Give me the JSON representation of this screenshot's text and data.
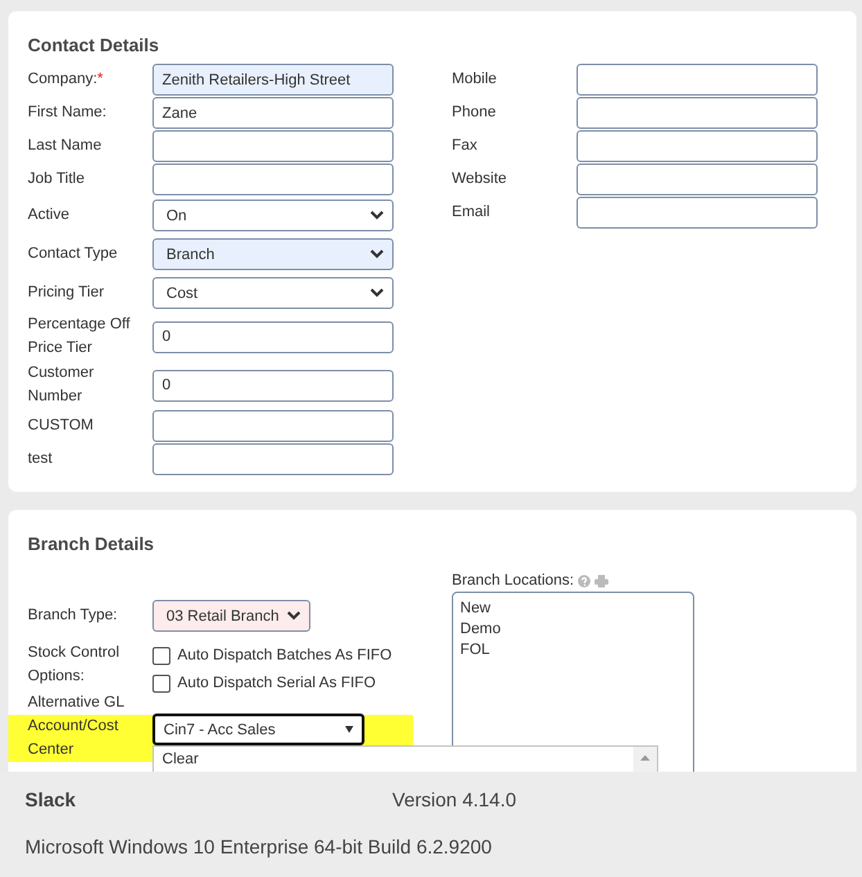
{
  "contact_details": {
    "title": "Contact Details",
    "fields_left": [
      {
        "label": "Company:",
        "required_mark": "*",
        "kind": "text",
        "value": "Zenith Retailers-High Street",
        "autofilled": true
      },
      {
        "label": "First Name:",
        "kind": "text",
        "value": "Zane",
        "autofilled": false
      },
      {
        "label": "Last Name",
        "kind": "text",
        "autofilled": false
      },
      {
        "label": "Job Title",
        "kind": "text",
        "autofilled": false
      },
      {
        "label": "Active",
        "kind": "select",
        "value": "On",
        "autofilled": false
      },
      {
        "label": "Contact Type",
        "kind": "select",
        "value": "Branch",
        "autofilled": true
      },
      {
        "label": "Pricing Tier",
        "kind": "select",
        "value": "Cost",
        "autofilled": false
      },
      {
        "label": "Percentage Off Price Tier",
        "kind": "text",
        "value": "0",
        "autofilled": false
      },
      {
        "label": "Customer Number",
        "kind": "text",
        "value": "0",
        "autofilled": false
      },
      {
        "label": "CUSTOM",
        "kind": "text",
        "autofilled": false
      },
      {
        "label": "test",
        "kind": "text",
        "autofilled": false
      }
    ],
    "fields_right": [
      {
        "label": "Mobile",
        "kind": "text"
      },
      {
        "label": "Phone",
        "kind": "text"
      },
      {
        "label": "Fax",
        "kind": "text"
      },
      {
        "label": "Website",
        "kind": "text"
      },
      {
        "label": "Email",
        "kind": "text"
      }
    ]
  },
  "branch_details": {
    "title": "Branch Details",
    "branch_type": {
      "label": "Branch Type:",
      "value": "03 Retail Branch",
      "flagged": true
    },
    "stock_control": {
      "label": "Stock Control Options:",
      "options": [
        {
          "label": "Auto Dispatch Batches As FIFO",
          "checked": false
        },
        {
          "label": "Auto Dispatch Serial As FIFO",
          "checked": false
        }
      ]
    },
    "gl_account": {
      "label": "Alternative GL Account/Cost Center",
      "value": "Cin7 - Acc Sales",
      "highlighted": true,
      "dropdown_items": [
        "Clear"
      ]
    },
    "branch_locations": {
      "label": "Branch Locations:",
      "items": [
        "New",
        "Demo",
        "FOL"
      ]
    }
  },
  "about": {
    "app_name": "Slack",
    "version": "Version 4.14.0",
    "os": "Microsoft Windows 10 Enterprise 64-bit Build 6.2.9200"
  }
}
